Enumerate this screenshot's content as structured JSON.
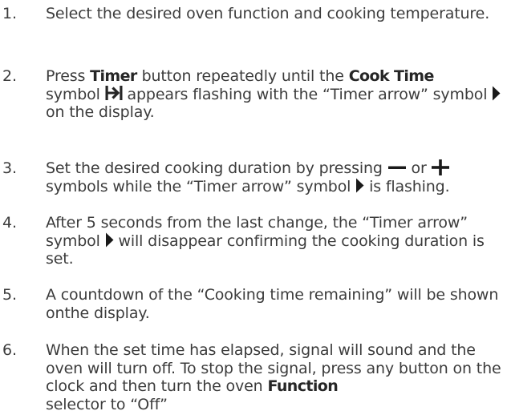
{
  "steps": [
    {
      "num": "1.",
      "text": "Select the desired oven function and cooking temperature."
    },
    {
      "num": "2.",
      "t1": "Press ",
      "b1": "Timer",
      "t2": " button repeatedly until the ",
      "b2": "Cook Time",
      "t3": "symbol ",
      "t4": " appears flashing with the “Timer arrow” symbol ",
      "t5": " on the display."
    },
    {
      "num": "3.",
      "t1": "Set the desired cooking duration by pressing ",
      "t2": " or ",
      "t3": "symbols while the “Timer arrow” symbol ",
      "t4": " is flashing."
    },
    {
      "num": "4.",
      "t1": "After 5 seconds from the last change, the “Timer arrow” symbol ",
      "t2": " will disappear confirming the cooking duration is set."
    },
    {
      "num": "5.",
      "text": "A countdown of the “Cooking time remaining” will be shown onthe display."
    },
    {
      "num": "6.",
      "t1": "When the set time has elapsed, signal will sound and the oven will turn off. To stop the signal, press any button on the clock and then turn the oven ",
      "b1": "Function",
      "t2": "selector to “Off”"
    }
  ],
  "icons": {
    "cook_time": "cook-time-icon",
    "timer_arrow": "timer-arrow-icon",
    "minus": "minus-icon",
    "plus": "plus-icon"
  }
}
